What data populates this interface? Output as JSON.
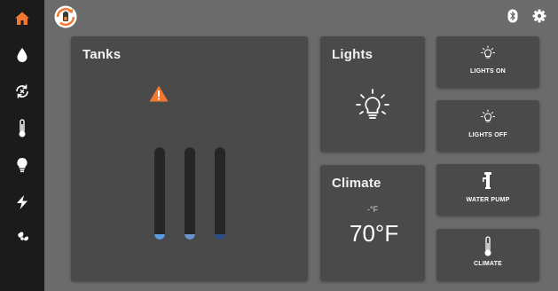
{
  "sidebar": {
    "items": [
      {
        "name": "home",
        "icon": "home-icon",
        "active": true
      },
      {
        "name": "water",
        "icon": "water-drop-icon",
        "active": false
      },
      {
        "name": "sync",
        "icon": "sync-icon",
        "active": false
      },
      {
        "name": "temperature",
        "icon": "thermometer-icon",
        "active": false
      },
      {
        "name": "lights",
        "icon": "lightbulb-icon",
        "active": false
      },
      {
        "name": "power",
        "icon": "lightning-icon",
        "active": false
      },
      {
        "name": "fan",
        "icon": "fan-icon",
        "active": false
      }
    ]
  },
  "header": {
    "brand_icon": "battery-sync-logo",
    "icons": [
      "bluetooth-icon",
      "settings-gear-icon"
    ]
  },
  "tanks": {
    "title": "Tanks",
    "warning_icon": "warning-triangle-icon",
    "levels": [
      {
        "name": "tank-1",
        "level_fraction": 0.06,
        "color": "#5a9be0"
      },
      {
        "name": "tank-2",
        "level_fraction": 0.06,
        "color": "#6c94c9"
      },
      {
        "name": "tank-3",
        "level_fraction": 0.06,
        "color": "#2b4f86"
      }
    ]
  },
  "lights": {
    "title": "Lights",
    "icon": "lightbulb-on-icon"
  },
  "climate": {
    "title": "Climate",
    "secondary": "-°F",
    "temperature": "70°F"
  },
  "buttons": {
    "lights_on": "LIGHTS ON",
    "lights_off": "LIGHTS OFF",
    "water_pump": "WATER PUMP",
    "climate": "CLIMATE"
  },
  "colors": {
    "accent_orange": "#f07830",
    "panel_bg": "#4a4a4a",
    "main_bg": "#6b6b6b",
    "sidebar_bg": "#1b1b1b"
  }
}
